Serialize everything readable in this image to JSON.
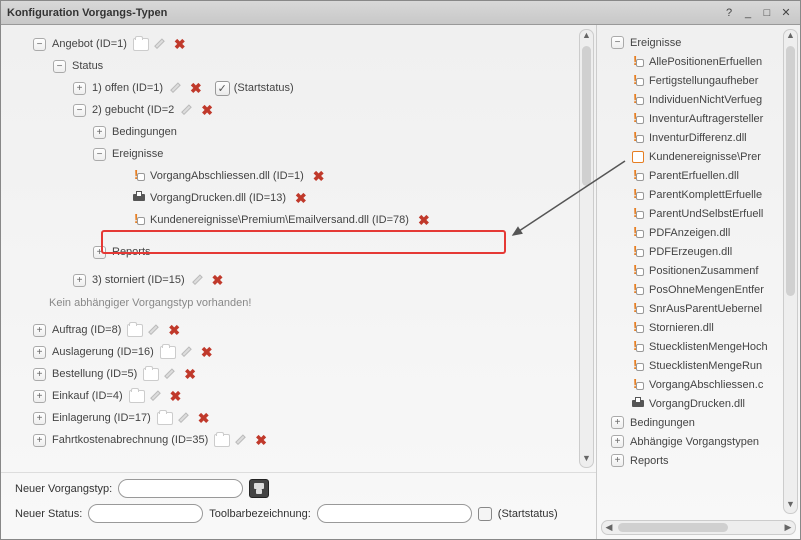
{
  "window": {
    "title": "Konfiguration Vorgangs-Typen"
  },
  "left_tree": {
    "root": {
      "label": "Angebot (ID=1)",
      "status_label": "Status",
      "statuses": [
        {
          "label": "1) offen (ID=1)",
          "startstatus_text": "(Startstatus)"
        },
        {
          "label": "2) gebucht (ID=2",
          "bedingungen": "Bedingungen",
          "ereignisse": "Ereignisse",
          "events": [
            {
              "icon": "exclaim",
              "label": "VorgangAbschliessen.dll (ID=1)"
            },
            {
              "icon": "printer",
              "label": "VorgangDrucken.dll (ID=13)"
            },
            {
              "icon": "exclaim",
              "label": "Kundenereignisse\\Premium\\Emailversand.dll (ID=78)"
            }
          ],
          "reports": "Reports"
        },
        {
          "label": "3) storniert (ID=15)"
        }
      ],
      "no_dep": "Kein abhängiger Vorgangstyp vorhanden!"
    },
    "others": [
      {
        "label": "Auftrag (ID=8)"
      },
      {
        "label": "Auslagerung (ID=16)"
      },
      {
        "label": "Bestellung (ID=5)"
      },
      {
        "label": "Einkauf (ID=4)"
      },
      {
        "label": "Einlagerung (ID=17)"
      },
      {
        "label": "Fahrtkostenabrechnung (ID=35)"
      }
    ]
  },
  "right_tree": {
    "root": "Ereignisse",
    "items": [
      "AllePositionenErfuellen",
      "Fertigstellungaufheber",
      "IndividuenNichtVerfueg",
      "InventurAuftragersteller",
      "InventurDifferenz.dll",
      "Kundenereignisse\\Prer",
      "ParentErfuellen.dll",
      "ParentKomplettErfuelle",
      "ParentUndSelbstErfuell",
      "PDFAnzeigen.dll",
      "PDFErzeugen.dll",
      "PositionenZusammenf",
      "PosOhneMengenEntfer",
      "SnrAusParentUebernel",
      "Stornieren.dll",
      "StuecklistenMengeHoch",
      "StuecklistenMengeRun",
      "VorgangAbschliessen.c",
      "VorgangDrucken.dll"
    ],
    "bedingungen": "Bedingungen",
    "abhaengige": "Abhängige Vorgangstypen",
    "reports": "Reports"
  },
  "form": {
    "new_type": "Neuer Vorgangstyp:",
    "new_status": "Neuer Status:",
    "toolbar_label": "Toolbarbezeichnung:",
    "startstatus": "(Startstatus)"
  }
}
